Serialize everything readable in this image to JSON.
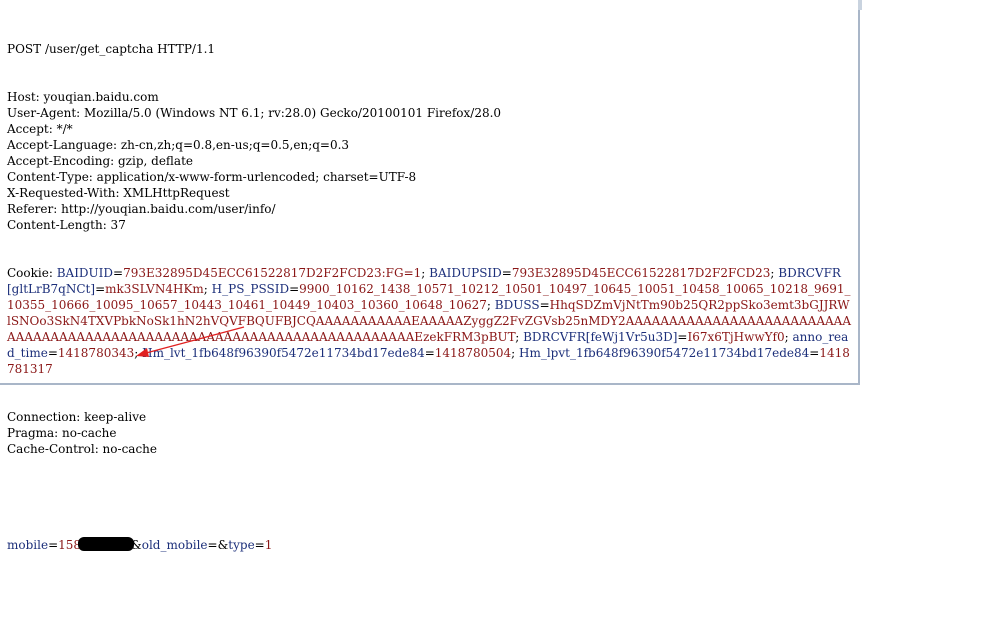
{
  "request": {
    "request_line": "POST /user/get_captcha HTTP/1.1",
    "headers": [
      "Host: youqian.baidu.com",
      "User-Agent: Mozilla/5.0 (Windows NT 6.1; rv:28.0) Gecko/20100101 Firefox/28.0",
      "Accept: */*",
      "Accept-Language: zh-cn,zh;q=0.8,en-us;q=0.5,en;q=0.3",
      "Accept-Encoding: gzip, deflate",
      "Content-Type: application/x-www-form-urlencoded; charset=UTF-8",
      "X-Requested-With: XMLHttpRequest",
      "Referer: http://youqian.baidu.com/user/info/",
      "Content-Length: 37"
    ],
    "cookie_label": "Cookie: ",
    "cookies": [
      {
        "k": "BAIDUID",
        "v": "793E32895D45ECC61522817D2F2FCD23:FG=1"
      },
      {
        "k": "BAIDUPSID",
        "v": "793E32895D45ECC61522817D2F2FCD23"
      },
      {
        "k": "BDRCVFR[gltLrB7qNCt]",
        "v": "mk3SLVN4HKm"
      },
      {
        "k": "H_PS_PSSID",
        "v": "9900_10162_1438_10571_10212_10501_10497_10645_10051_10458_10065_10218_9691_10355_10666_10095_10657_10443_10461_10449_10403_10360_10648_10627"
      },
      {
        "k": "BDUSS",
        "v": "HhqSDZmVjNtTm90b25QR2ppSko3emt3bGJJRWlSNOo3SkN4TXVPbkNoSk1hN2hVQVFBQUFBJCQAAAAAAAAAAAEAAAAAZyggZ2FvZGVsb25nMDY2AAAAAAAAAAAAAAAAAAAAAAAAAAAAAAAAAAAAAAAAAAAAAAAAAAAAAAAAAAAAAAAAAAAAAAAAAEzekFRM3pBUT"
      },
      {
        "k": "BDRCVFR[feWj1Vr5u3D]",
        "v": "I67x6TjHwwYf0"
      },
      {
        "k": "anno_read_time",
        "v": "1418780343"
      },
      {
        "k": "Hm_lvt_1fb648f96390f5472e11734bd17ede84",
        "v": "1418780504"
      },
      {
        "k": "Hm_lpvt_1fb648f96390f5472e11734bd17ede84",
        "v": "1418781317"
      }
    ],
    "trailing_headers": [
      "Connection: keep-alive",
      "Pragma: no-cache",
      "Cache-Control: no-cache"
    ],
    "body": {
      "mobile_key": "mobile",
      "mobile_value_visible": "158",
      "old_mobile_key": "old_mobile",
      "old_mobile_value": "",
      "type_key": "type",
      "type_value": "1"
    }
  },
  "colors": {
    "key": "#1c2f7a",
    "value": "#8a1616",
    "arrow": "#e02020",
    "border": "#a9b6c8"
  }
}
